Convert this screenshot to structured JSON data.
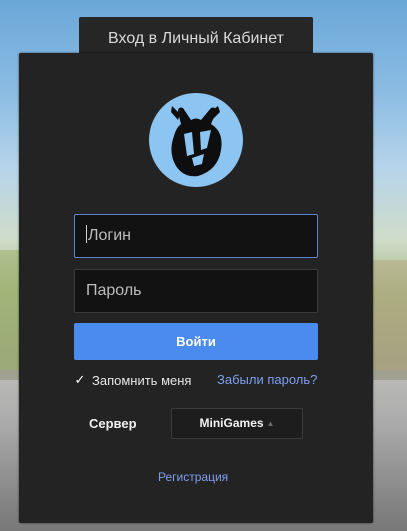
{
  "window": {
    "tab_title": "Вход в Личный Кабинет"
  },
  "logo": {
    "icon": "mascot-logo-icon",
    "bg_color": "#8cc4f2"
  },
  "form": {
    "login_placeholder": "Логин",
    "password_placeholder": "Пароль",
    "submit_label": "Войти",
    "remember_label": "Запомнить меня",
    "remember_checked": true,
    "forgot_label": "Забыли пароль?",
    "server_label": "Сервер",
    "server_value": "MiniGames",
    "register_label": "Регистрация"
  },
  "colors": {
    "accent": "#4b8bf0",
    "link": "#7f9ff0",
    "panel": "#232323"
  }
}
